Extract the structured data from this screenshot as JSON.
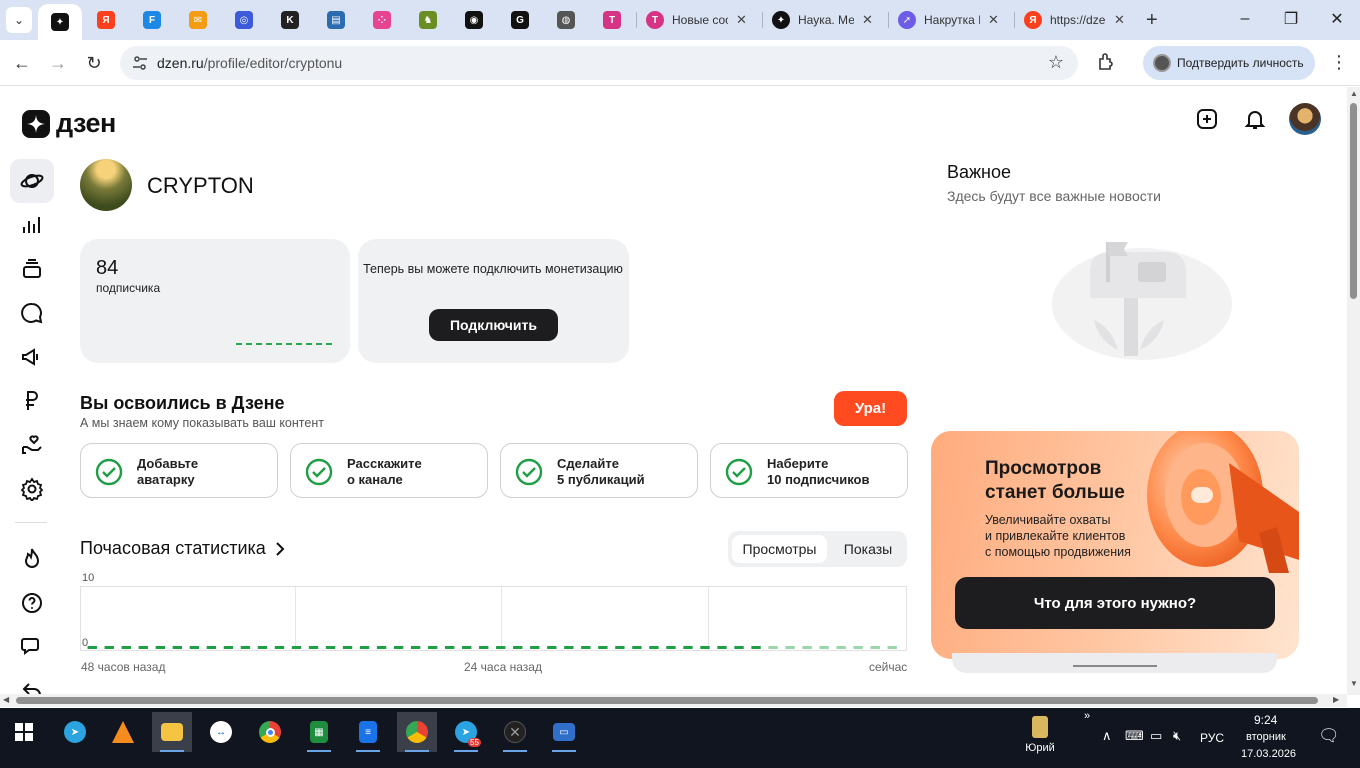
{
  "browser": {
    "pinned_tabs": [
      {
        "icon": "dzen-icon",
        "color": "#111111"
      },
      {
        "icon": "yandex-icon",
        "color": "#fc3f1d"
      },
      {
        "icon": "f-app-icon",
        "color": "#1e88e5"
      },
      {
        "icon": "mail-icon",
        "color": "#f39c12"
      },
      {
        "icon": "globe-swirl-icon",
        "color": "#3b5bdb"
      },
      {
        "icon": "k-app-icon",
        "color": "#222222"
      },
      {
        "icon": "bus-icon",
        "color": "#2b6cb0"
      },
      {
        "icon": "dots-app-icon",
        "color": "#e84393"
      },
      {
        "icon": "figure-icon",
        "color": "#6b8e23"
      },
      {
        "icon": "eye-app-icon",
        "color": "#111111"
      },
      {
        "icon": "gpt-icon",
        "color": "#111111"
      },
      {
        "icon": "globe-icon",
        "color": "#555555"
      },
      {
        "icon": "t-shield-icon",
        "color": "#d63384"
      }
    ],
    "tabs": [
      {
        "title": "Новые соо",
        "icon": "t-shield-icon"
      },
      {
        "title": "Наука. Ме",
        "icon": "dzen-icon"
      },
      {
        "title": "Накрутка I",
        "icon": "rocket-icon"
      },
      {
        "title": "https://dze",
        "icon": "yandex-icon"
      }
    ],
    "url_host": "dzen.ru",
    "url_path": "/profile/editor/cryptonu",
    "verify_label": "Подтвердить личность"
  },
  "header": {
    "logo_text": "дзен"
  },
  "profile": {
    "name": "CRYPTON"
  },
  "subscribers": {
    "count": "84",
    "label": "подписчика"
  },
  "monetization": {
    "text": "Теперь вы можете подключить монетизацию",
    "button": "Подключить"
  },
  "onboarding": {
    "title": "Вы освоились в Дзене",
    "subtitle": "А мы знаем кому показывать ваш контент",
    "ura_button": "Ура!",
    "tasks": [
      {
        "line1": "Добавьте",
        "line2": "аватарку"
      },
      {
        "line1": "Расскажите",
        "line2": "о канале"
      },
      {
        "line1": "Сделайте",
        "line2": "5 публикаций"
      },
      {
        "line1": "Наберите",
        "line2": "10 подписчиков"
      }
    ]
  },
  "stats": {
    "title": "Почасовая статистика",
    "tab_views": "Просмотры",
    "tab_shows": "Показы"
  },
  "chart_data": {
    "type": "line",
    "title": "",
    "xlabel": "",
    "ylabel": "",
    "ylim": [
      0,
      10
    ],
    "y_ticks": [
      "10",
      "0"
    ],
    "x_ticks": [
      "48 часов назад",
      "24 часа назад",
      "сейчас"
    ],
    "series": [
      {
        "values": [
          0,
          0,
          0,
          0,
          0,
          0,
          0,
          0,
          0,
          0,
          0,
          0,
          0,
          0,
          0,
          0,
          0,
          0,
          0,
          0,
          0,
          0,
          0,
          0,
          0,
          0,
          0,
          0,
          0,
          0,
          0,
          0,
          0,
          0,
          0,
          0,
          0,
          0,
          0,
          0,
          0,
          0,
          0,
          0,
          0,
          0,
          0,
          0
        ],
        "color": "#1fa045"
      }
    ],
    "grid": true,
    "legend": "none"
  },
  "important": {
    "title": "Важное",
    "subtitle": "Здесь будут все важные новости"
  },
  "promo": {
    "title_line1": "Просмотров",
    "title_line2": "станет больше",
    "sub_line1": "Увеличивайте охваты",
    "sub_line2": "и привлекайте клиентов",
    "sub_line3": "с помощью продвижения",
    "button": "Что для этого нужно?"
  },
  "taskbar": {
    "user_label": "Юрий",
    "lang": "РУС",
    "time": "9:24",
    "day": "вторник",
    "date": "17.03.2026",
    "unread_badge": "55"
  }
}
